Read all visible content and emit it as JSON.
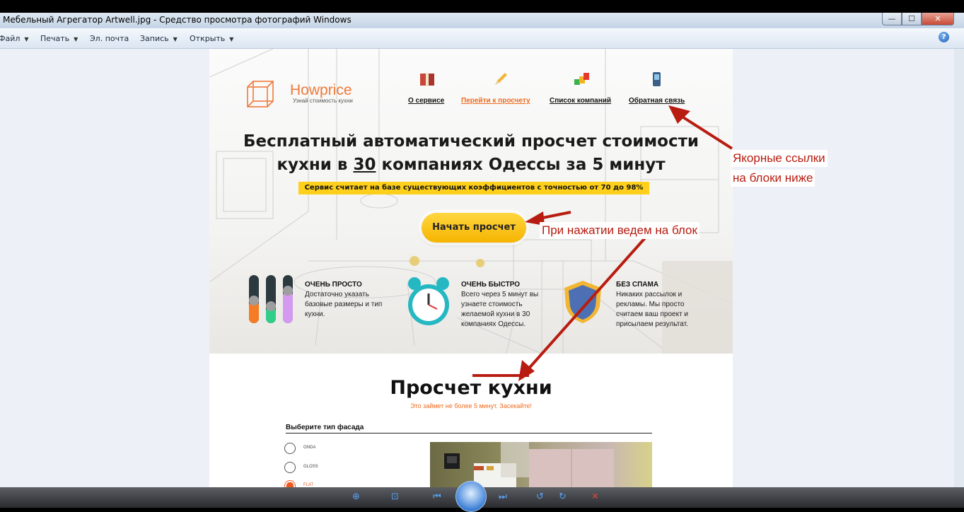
{
  "window": {
    "title": "Мебельный Агрегатор Artwell.jpg - Средство просмотра фотографий Windows"
  },
  "menu": {
    "items": [
      "Файл",
      "Печать",
      "Эл. почта",
      "Запись",
      "Открыть"
    ]
  },
  "site": {
    "logo_name": "Howprice",
    "logo_tagline": "Узнай стоимость кухни",
    "nav": [
      {
        "label": "О сервисе",
        "icon": "book-icon"
      },
      {
        "label": "Перейти к просчету",
        "icon": "pencil-icon"
      },
      {
        "label": "Список компаний",
        "icon": "blocks-icon"
      },
      {
        "label": "Обратная связь",
        "icon": "phone-icon"
      }
    ],
    "headline_line1": "Бесплатный автоматический просчет стоимости",
    "headline_line2_pre": "кухни в ",
    "headline_number": "30",
    "headline_line2_post": " компаниях Одессы за 5 минут",
    "accuracy_note": "Сервис считает на базе существующих коэффициентов с точностью от 70 до 98%",
    "cta_label": "Начать просчет",
    "features": [
      {
        "title": "ОЧЕНЬ ПРОСТО",
        "text": "Достаточно указать базовые размеры и тип кухни.",
        "icon": "sliders-icon"
      },
      {
        "title": "ОЧЕНЬ БЫСТРО",
        "text": "Всего через 5 минут вы узнаете стоимость желаемой кухни в 30 компаниях Одессы.",
        "icon": "alarm-clock-icon"
      },
      {
        "title": "БЕЗ СПАМА",
        "text": "Никаких рассылок и рекламы. Мы просто считаем ваш проект и присылаем результат.",
        "icon": "shield-icon"
      }
    ],
    "section_title": "Просчет кухни",
    "section_subtitle": "Это займет не более 5 минут. Засекайте!",
    "facade_label": "Выберите тип фасада",
    "facade_options": [
      {
        "label": "ONDA",
        "selected": false
      },
      {
        "label": "GLOSS",
        "selected": false
      },
      {
        "label": "FLAT",
        "selected": true
      }
    ]
  },
  "annotations": {
    "anchor_links_line1": "Якорные ссылки",
    "anchor_links_line2": "на блоки ниже",
    "click_note": "При нажатии ведем на блок"
  },
  "colors": {
    "accent_orange": "#f06a1c",
    "cta_yellow": "#fed01b",
    "annotation_red": "#b81c10"
  }
}
